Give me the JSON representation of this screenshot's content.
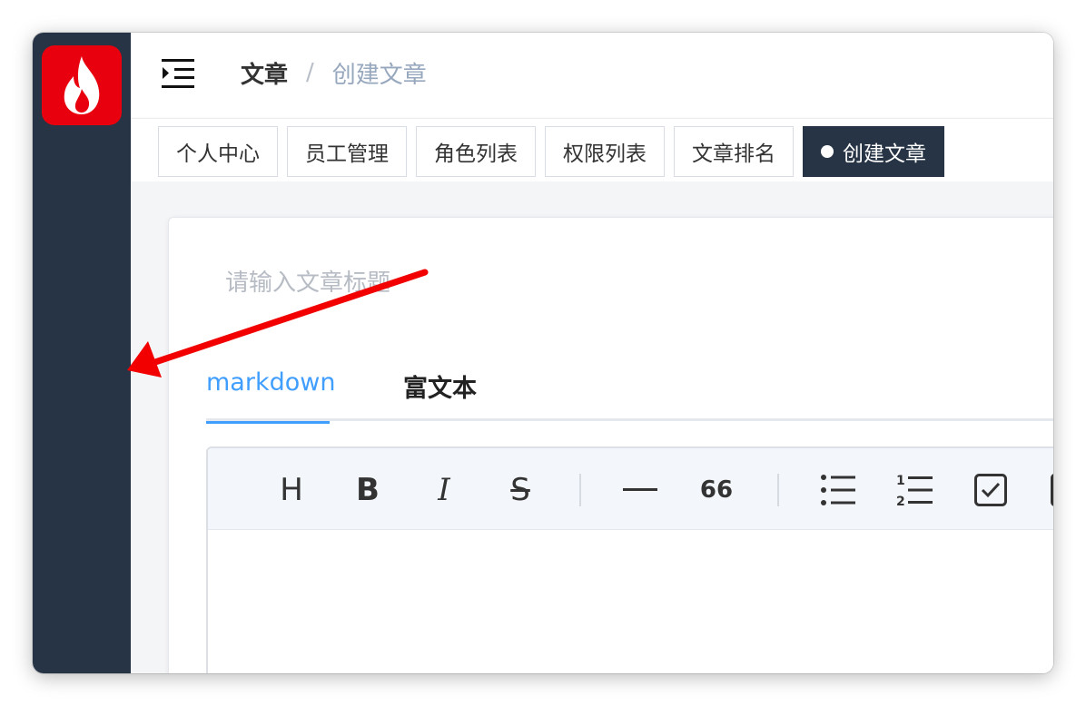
{
  "breadcrumb": {
    "root": "文章",
    "separator": "/",
    "current": "创建文章"
  },
  "tags": [
    {
      "label": "个人中心",
      "active": false
    },
    {
      "label": "员工管理",
      "active": false
    },
    {
      "label": "角色列表",
      "active": false
    },
    {
      "label": "权限列表",
      "active": false
    },
    {
      "label": "文章排名",
      "active": false
    },
    {
      "label": "创建文章",
      "active": true
    }
  ],
  "article": {
    "title_placeholder": "请输入文章标题",
    "title_value": ""
  },
  "editor_tabs": [
    {
      "label": "markdown",
      "active": true
    },
    {
      "label": "富文本",
      "active": false
    }
  ],
  "toolbar": {
    "heading_glyph": "H",
    "bold_glyph": "B",
    "italic_glyph": "I",
    "strike_glyph": "S",
    "quote_glyph": "66",
    "icons": [
      "heading-icon",
      "bold-icon",
      "italic-icon",
      "strikethrough-icon",
      "horizontal-rule-icon",
      "quote-icon",
      "bullet-list-icon",
      "numbered-list-icon",
      "task-list-icon"
    ]
  },
  "colors": {
    "sidebar": "#263445",
    "logo": "#e8000e",
    "accent": "#409eff",
    "arrow": "#f20000"
  }
}
